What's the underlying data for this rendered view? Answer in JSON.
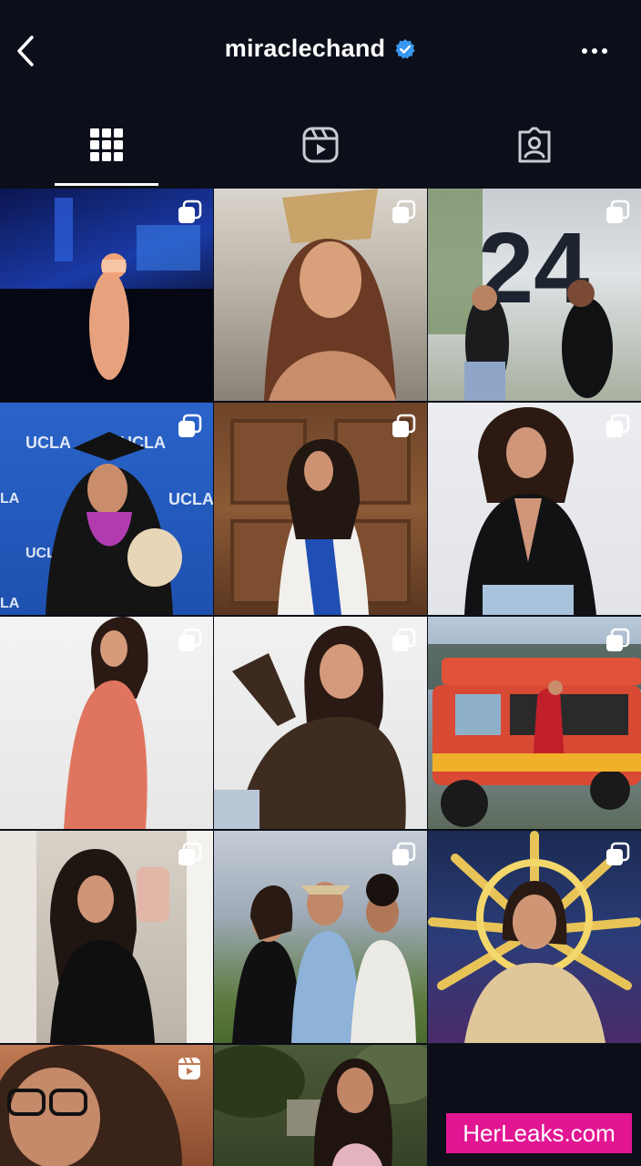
{
  "header": {
    "username": "miraclechand",
    "back_icon": "chevron-left-icon",
    "verified_icon": "verified-badge-icon",
    "more_icon": "more-horizontal-icon"
  },
  "tabs": [
    {
      "icon": "grid-icon",
      "active": true
    },
    {
      "icon": "reels-icon",
      "active": false
    },
    {
      "icon": "tagged-icon",
      "active": false
    }
  ],
  "posts": [
    {
      "type": "carousel",
      "scene": "concert stage at night"
    },
    {
      "type": "carousel",
      "scene": "selfie with crown"
    },
    {
      "type": "carousel",
      "scene": "24 birthday balloons"
    },
    {
      "type": "carousel",
      "scene": "UCLA commencement"
    },
    {
      "type": "carousel",
      "scene": "graduate by wooden door"
    },
    {
      "type": "carousel",
      "scene": "black blazer portrait"
    },
    {
      "type": "carousel",
      "scene": "coral jumpsuit"
    },
    {
      "type": "carousel",
      "scene": "brown sweatshirt"
    },
    {
      "type": "carousel",
      "scene": "jeepney photo"
    },
    {
      "type": "carousel",
      "scene": "mirror selfie"
    },
    {
      "type": "carousel",
      "scene": "group photo outdoors"
    },
    {
      "type": "carousel",
      "scene": "golden sun headdress"
    },
    {
      "type": "reel",
      "scene": "close-up with glasses"
    },
    {
      "type": "post",
      "scene": "outdoor portrait"
    }
  ],
  "colors": {
    "background": "#0c0f1a",
    "verified": "#3897f0",
    "watermark": "#e21593"
  },
  "watermark": {
    "text": "HerLeaks.com"
  }
}
